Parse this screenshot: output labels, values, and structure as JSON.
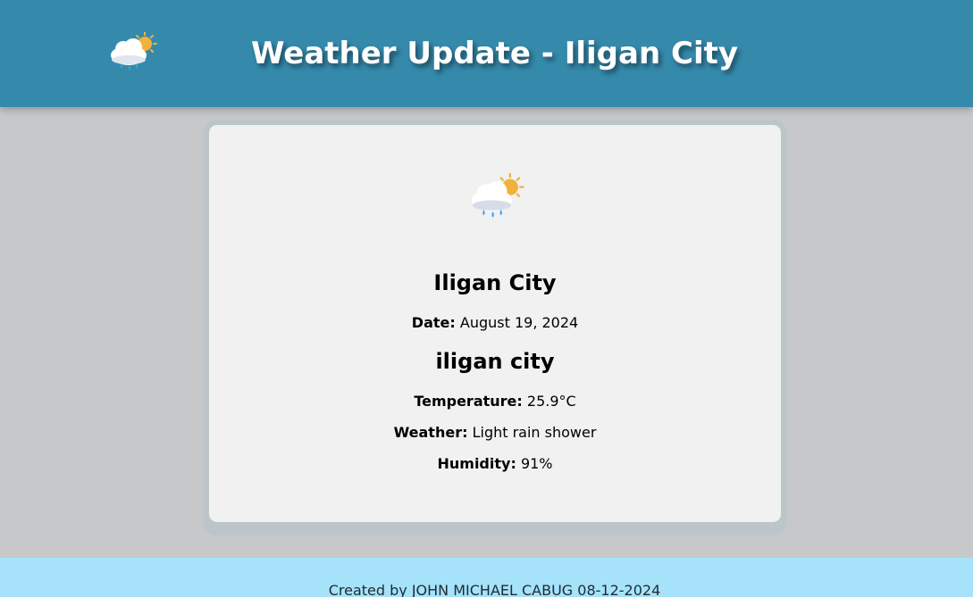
{
  "header": {
    "title": "Weather Update - Iligan City",
    "icon": "rain-cloud-sun-icon"
  },
  "card": {
    "icon": "rain-cloud-sun-icon",
    "city_title": "Iligan City",
    "date_label": "Date:",
    "date_value": "August 19, 2024",
    "location_name": "iligan city",
    "temperature_label": "Temperature:",
    "temperature_value": "25.9°C",
    "weather_label": "Weather:",
    "weather_value": "Light rain shower",
    "humidity_label": "Humidity:",
    "humidity_value": "91%"
  },
  "footer": {
    "text": "Created by JOHN MICHAEL CABUG 08-12-2024"
  },
  "colors": {
    "header_bg": "#358aac",
    "page_bg": "#c7c8ca",
    "card_bg": "#f0f1f0",
    "footer_bg": "#a6e3fb"
  }
}
